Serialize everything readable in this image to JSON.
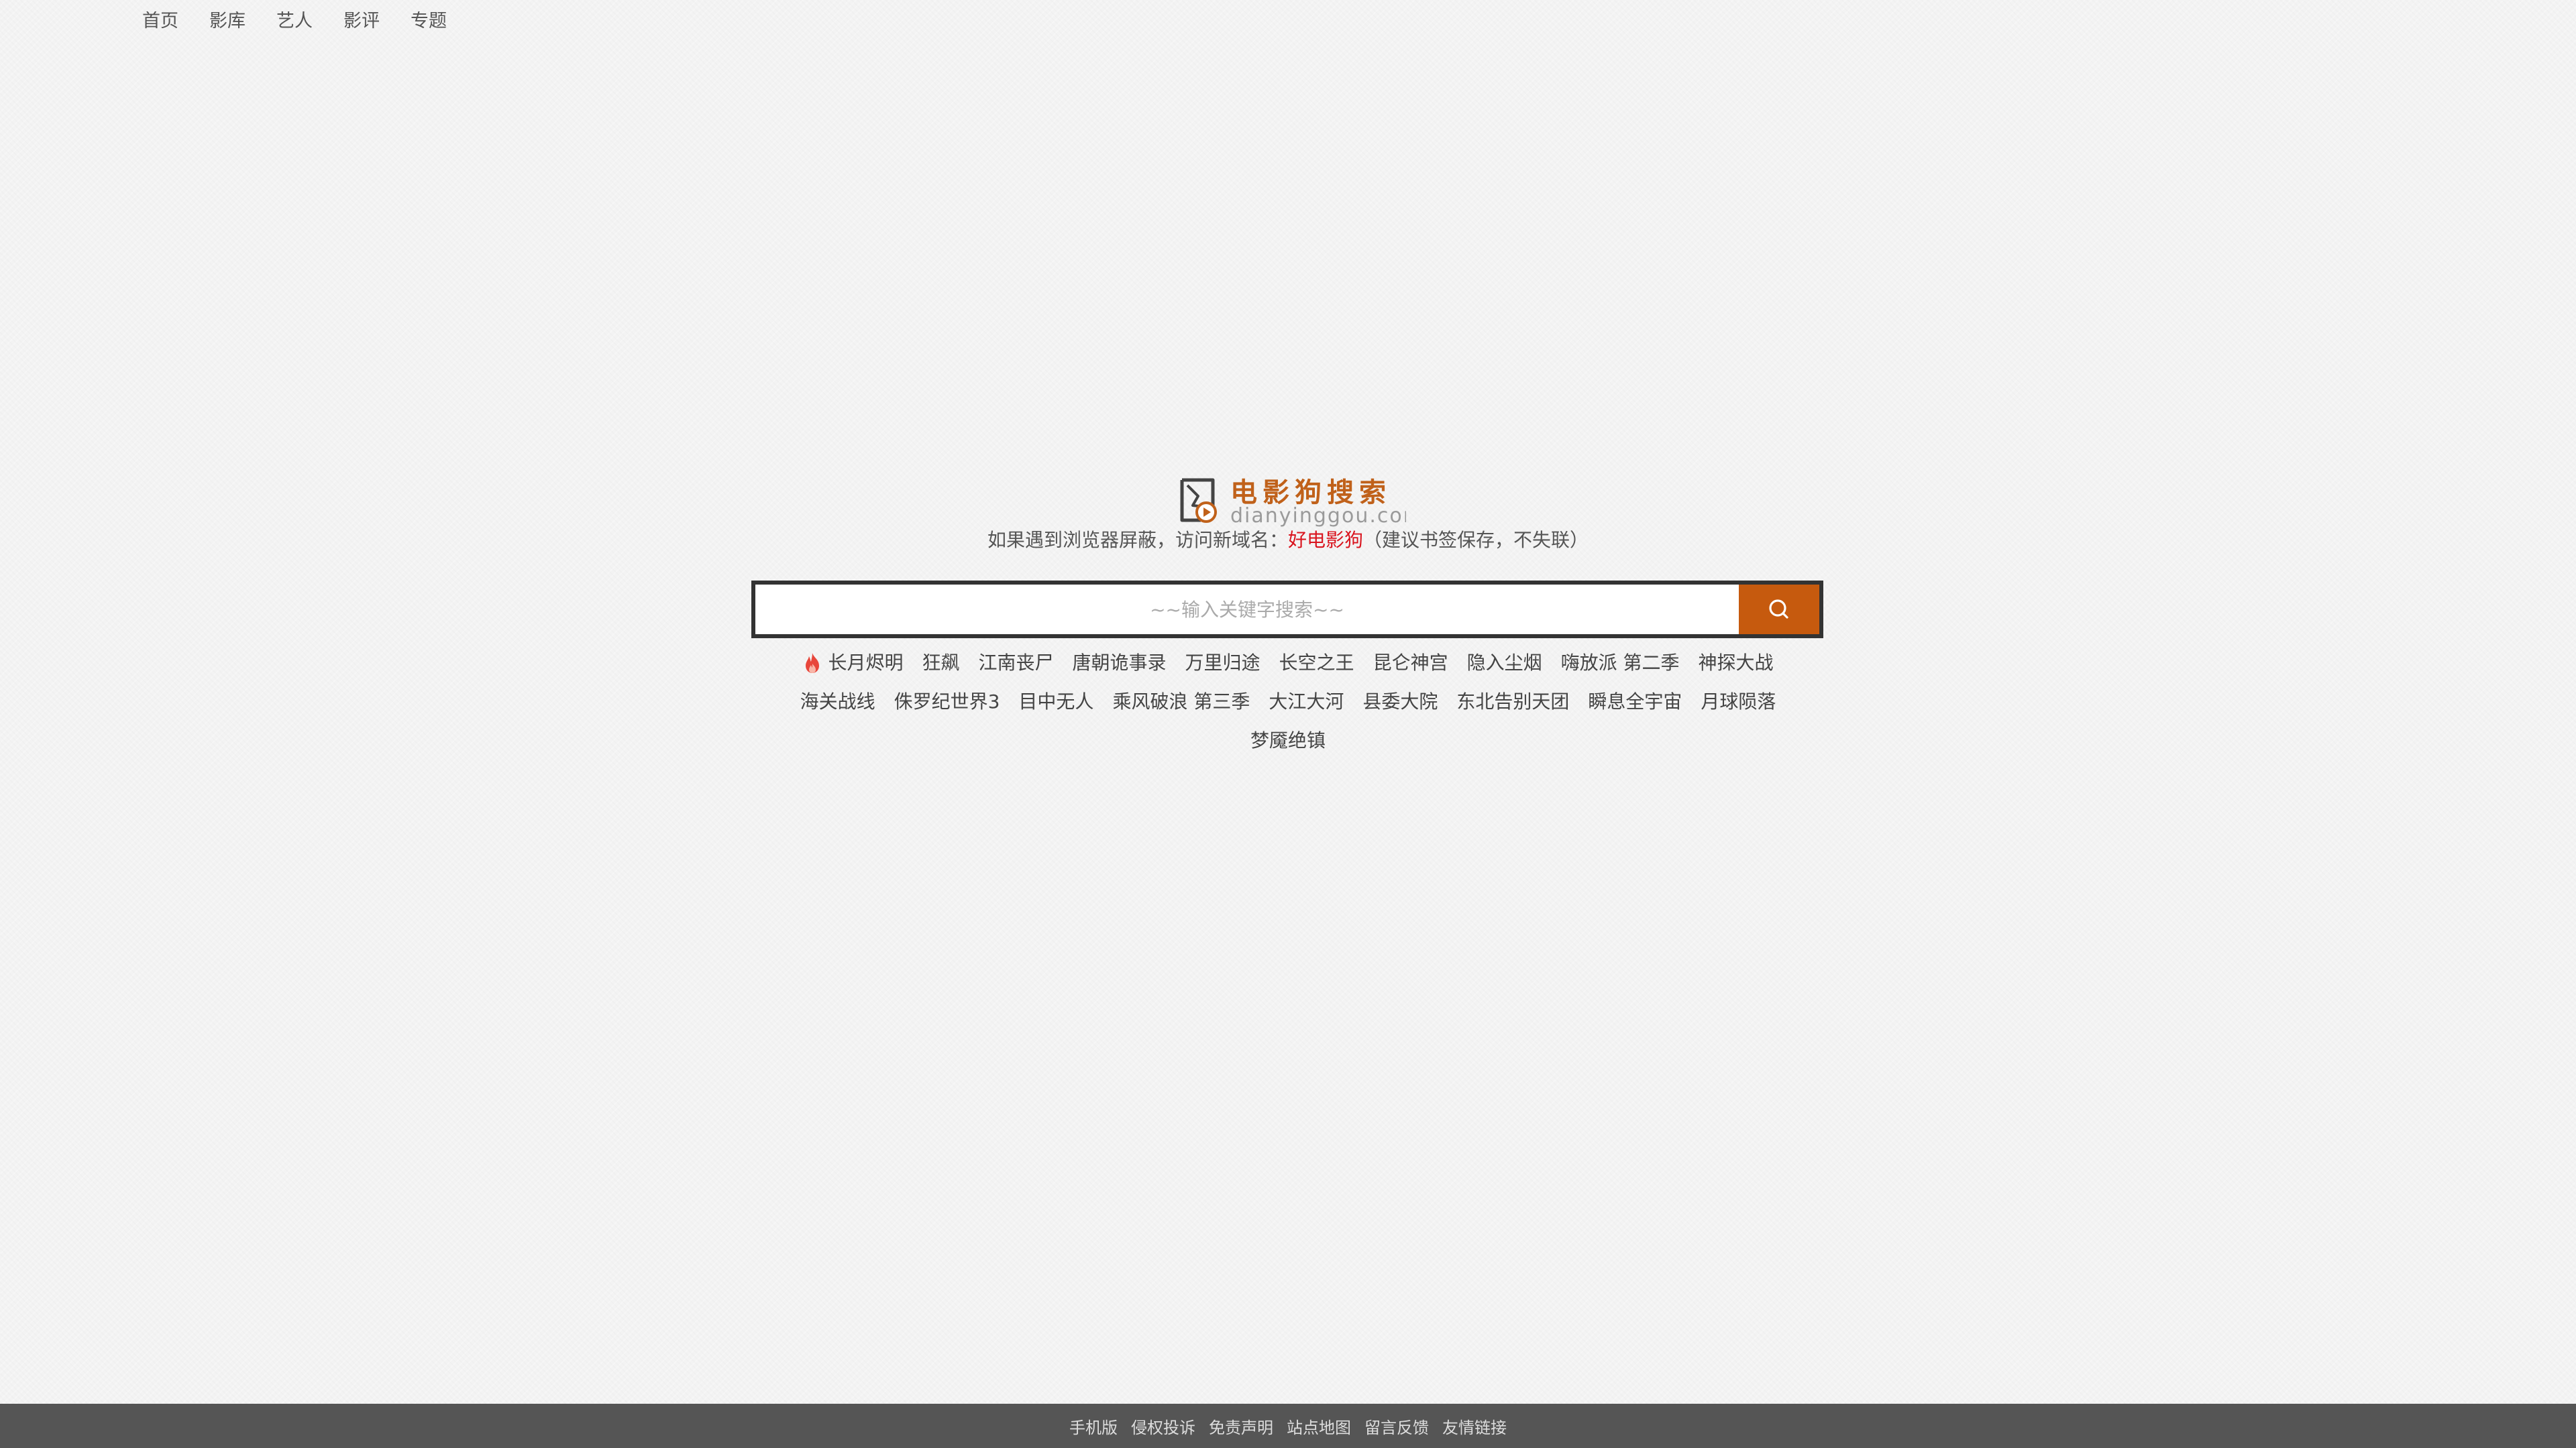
{
  "nav": {
    "items": [
      {
        "label": "首页"
      },
      {
        "label": "影库"
      },
      {
        "label": "艺人"
      },
      {
        "label": "影评"
      },
      {
        "label": "专题"
      }
    ]
  },
  "logo": {
    "title": "电影狗搜索",
    "subtitle": "dianyinggou.com",
    "icon": "film-play-icon"
  },
  "notice": {
    "prefix": "如果遇到浏览器屏蔽，访问新域名：",
    "link": "好电影狗",
    "suffix": "（建议书签保存，不失联）"
  },
  "search": {
    "value": "",
    "placeholder": "~~输入关键字搜索~~",
    "button_icon": "search-icon"
  },
  "hot_keywords": [
    "长月烬明",
    "狂飙",
    "江南丧尸",
    "唐朝诡事录",
    "万里归途",
    "长空之王",
    "昆仑神宫",
    "隐入尘烟",
    "嗨放派 第二季",
    "神探大战",
    "海关战线",
    "侏罗纪世界3",
    "目中无人",
    "乘风破浪 第三季",
    "大江大河",
    "县委大院",
    "东北告别天团",
    "瞬息全宇宙",
    "月球陨落",
    "梦魇绝镇"
  ],
  "footer": {
    "links": [
      {
        "label": "手机版"
      },
      {
        "label": "侵权投诉"
      },
      {
        "label": "免责声明"
      },
      {
        "label": "站点地图"
      },
      {
        "label": "留言反馈"
      },
      {
        "label": "友情链接"
      }
    ]
  },
  "colors": {
    "brand": "#c0611a",
    "button": "#c65a0e",
    "link_red": "#d9141e",
    "footer_bg": "#555555"
  }
}
